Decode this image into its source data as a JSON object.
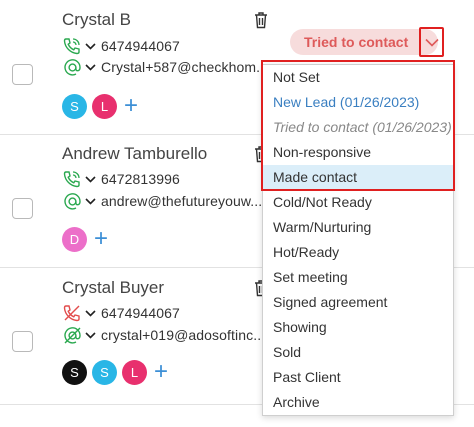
{
  "contacts": [
    {
      "name": "Crystal B",
      "phone": "6474944067",
      "email": "Crystal+587@checkhom...",
      "tags": [
        {
          "letter": "S",
          "color": "#29b6e6"
        },
        {
          "letter": "L",
          "color": "#e8306e"
        }
      ],
      "status": "Tried to contact"
    },
    {
      "name": "Andrew Tamburello",
      "phone": "6472813996",
      "email": "andrew@thefutureyouw...",
      "tags": [
        {
          "letter": "D",
          "color": "#ec6fc9"
        }
      ]
    },
    {
      "name": "Crystal Buyer",
      "phone": "6474944067",
      "email": "crystal+019@adosoftinc...",
      "tags": [
        {
          "letter": "S",
          "color": "#111111"
        },
        {
          "letter": "S",
          "color": "#29b6e6"
        },
        {
          "letter": "L",
          "color": "#e8306e"
        }
      ]
    }
  ],
  "status_menu": {
    "items": [
      "Not Set",
      "New Lead (01/26/2023)",
      "Tried to contact (01/26/2023)",
      "Non-responsive",
      "Made contact",
      "Cold/Not Ready",
      "Warm/Nurturing",
      "Hot/Ready",
      "Set meeting",
      "Signed agreement",
      "Showing",
      "Sold",
      "Past Client",
      "Archive"
    ],
    "highlighted": "Made contact"
  },
  "icons": {
    "phone": "phone-icon",
    "email": "at-icon",
    "trash": "trash-icon",
    "chevron": "chevron-down-icon",
    "add": "plus-icon"
  },
  "colors": {
    "icon_green": "#2aa84f",
    "icon_red": "#e24c4c",
    "link_blue": "#3a7fc1",
    "status_text": "#de5a5a",
    "status_bg": "#f7dcdc",
    "annotation_red": "#e02020"
  },
  "plus_symbol": "+"
}
